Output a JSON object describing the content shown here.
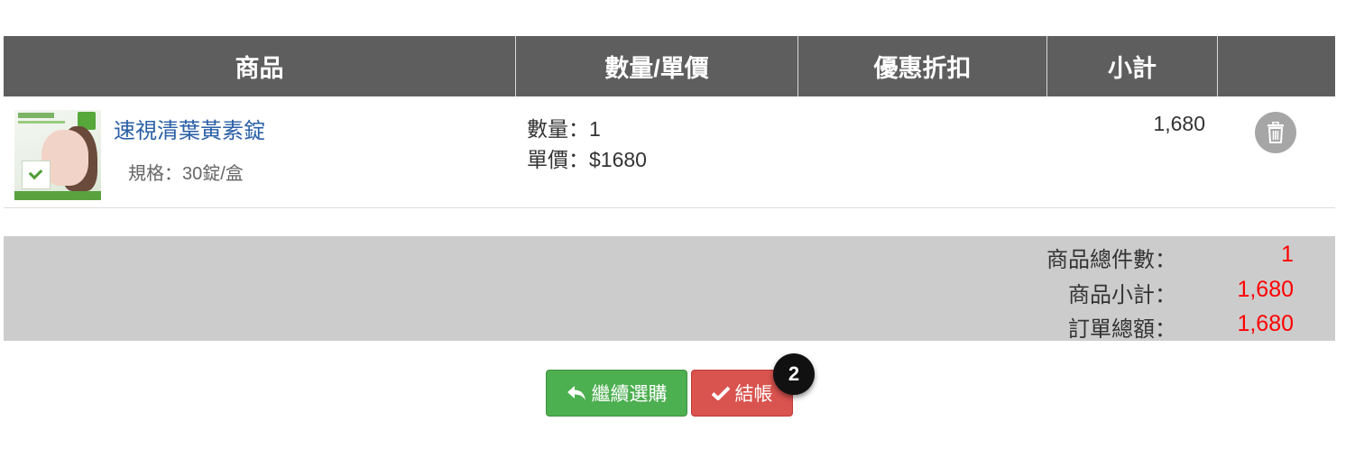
{
  "table": {
    "headers": [
      "商品",
      "數量/單價",
      "優惠折扣",
      "小計",
      ""
    ]
  },
  "cart": {
    "items": [
      {
        "name": "速視清葉黃素錠",
        "spec_label": "規格：",
        "spec_value": "30錠/盒",
        "quantity": "數量：1",
        "unit_price": "單價：$1680",
        "discount": "",
        "subtotal": "1,680",
        "delete_icon": "trash-icon"
      }
    ]
  },
  "summary": {
    "total_items_label": "商品總件數：",
    "total_items_value": "1",
    "subtotal_label": "商品小計：",
    "subtotal_value": "1,680",
    "order_total_label": "訂單總額：",
    "order_total_value": "1,680"
  },
  "buttons": {
    "continue_label": "繼續選購",
    "continue_icon": "reply-arrow-icon",
    "checkout_label": "結帳",
    "checkout_icon": "check-icon"
  },
  "annotation": {
    "marker_number": "2"
  },
  "colors": {
    "header_bg": "#5e5e5e",
    "link": "#2a5fa6",
    "summary_bg": "#cccccc",
    "summary_value": "#ff0000",
    "continue_btn": "#4caf50",
    "checkout_btn": "#d9534f"
  }
}
